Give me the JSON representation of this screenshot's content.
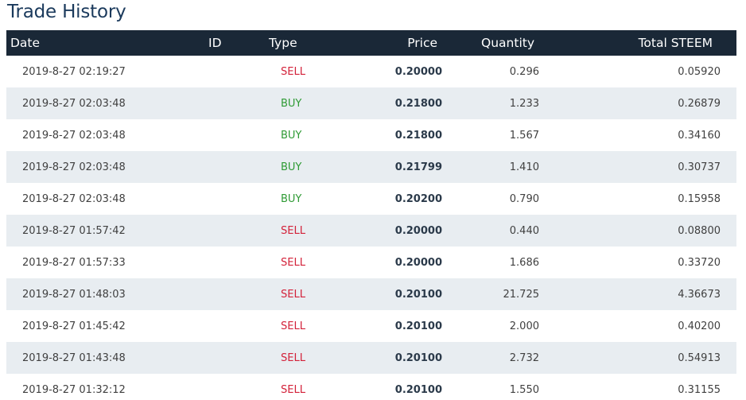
{
  "title": "Trade History",
  "colors": {
    "header_bg": "#1a2837",
    "title": "#1b3a5c",
    "sell": "#d3223a",
    "buy": "#2e9a34",
    "row_alt": "#e8edf1"
  },
  "columns": {
    "date": "Date",
    "id": "ID",
    "type": "Type",
    "price": "Price",
    "quantity": "Quantity",
    "total": "Total STEEM"
  },
  "rows": [
    {
      "date": "2019-8-27 02:19:27",
      "id": "",
      "type": "SELL",
      "price": "0.20000",
      "quantity": "0.296",
      "total": "0.05920"
    },
    {
      "date": "2019-8-27 02:03:48",
      "id": "",
      "type": "BUY",
      "price": "0.21800",
      "quantity": "1.233",
      "total": "0.26879"
    },
    {
      "date": "2019-8-27 02:03:48",
      "id": "",
      "type": "BUY",
      "price": "0.21800",
      "quantity": "1.567",
      "total": "0.34160"
    },
    {
      "date": "2019-8-27 02:03:48",
      "id": "",
      "type": "BUY",
      "price": "0.21799",
      "quantity": "1.410",
      "total": "0.30737"
    },
    {
      "date": "2019-8-27 02:03:48",
      "id": "",
      "type": "BUY",
      "price": "0.20200",
      "quantity": "0.790",
      "total": "0.15958"
    },
    {
      "date": "2019-8-27 01:57:42",
      "id": "",
      "type": "SELL",
      "price": "0.20000",
      "quantity": "0.440",
      "total": "0.08800"
    },
    {
      "date": "2019-8-27 01:57:33",
      "id": "",
      "type": "SELL",
      "price": "0.20000",
      "quantity": "1.686",
      "total": "0.33720"
    },
    {
      "date": "2019-8-27 01:48:03",
      "id": "",
      "type": "SELL",
      "price": "0.20100",
      "quantity": "21.725",
      "total": "4.36673"
    },
    {
      "date": "2019-8-27 01:45:42",
      "id": "",
      "type": "SELL",
      "price": "0.20100",
      "quantity": "2.000",
      "total": "0.40200"
    },
    {
      "date": "2019-8-27 01:43:48",
      "id": "",
      "type": "SELL",
      "price": "0.20100",
      "quantity": "2.732",
      "total": "0.54913"
    },
    {
      "date": "2019-8-27 01:32:12",
      "id": "",
      "type": "SELL",
      "price": "0.20100",
      "quantity": "1.550",
      "total": "0.31155"
    }
  ]
}
